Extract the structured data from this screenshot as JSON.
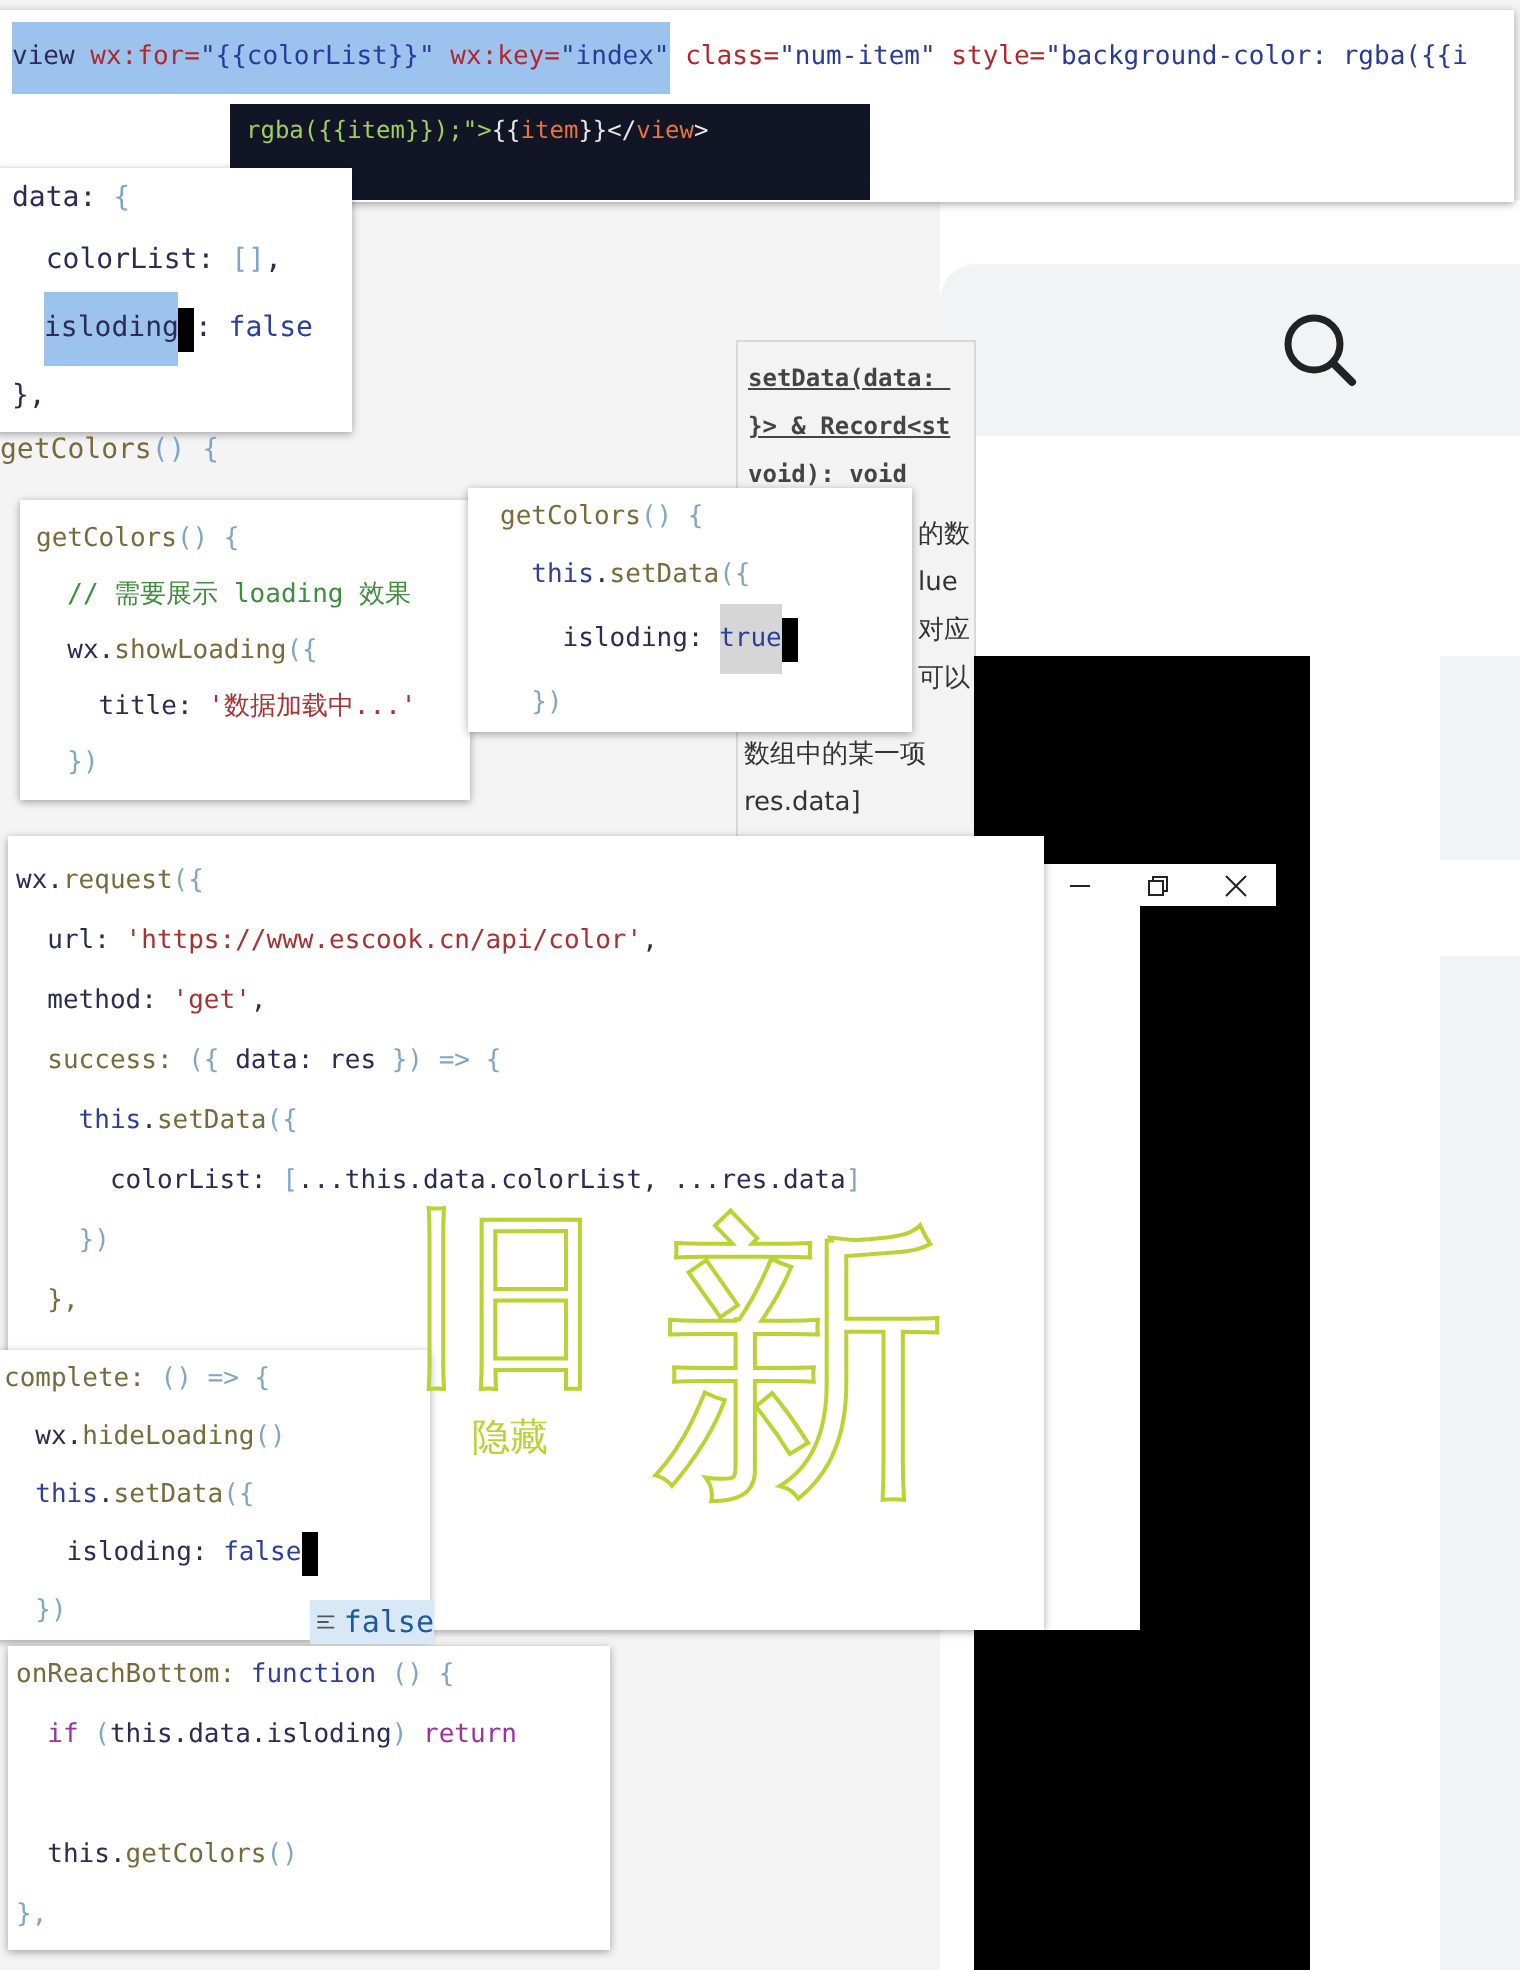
{
  "snippets": [
    {
      "kind": "wide",
      "lines": [
        {
          "segments": [
            {
              "text": "view ",
              "kind": "plain",
              "selected": true
            },
            {
              "text": "wx:for=",
              "kind": "tag",
              "selected": true
            },
            {
              "text": "\"{{colorList}}\"",
              "kind": "val",
              "selected": true
            },
            {
              "text": " wx:key=",
              "kind": "tag",
              "selected": true
            },
            {
              "text": "\"index\"",
              "kind": "val",
              "selected": true
            },
            {
              "text": " class=",
              "kind": "tag"
            },
            {
              "text": "\"num-item\"",
              "kind": "val"
            },
            {
              "text": " style=",
              "kind": "tag"
            },
            {
              "text": "\"background-color: rgba({{i",
              "kind": "val"
            }
          ]
        }
      ]
    },
    {
      "kind": "dark",
      "lines": [
        {
          "segments": [
            {
              "text": "rgba({{item}});\">",
              "kind": "str"
            },
            {
              "text": "{{",
              "kind": "plain"
            },
            {
              "text": "item",
              "kind": "tag"
            },
            {
              "text": "}}</",
              "kind": "plain"
            },
            {
              "text": "view",
              "kind": "tag"
            },
            {
              "text": ">",
              "kind": "plain"
            }
          ]
        }
      ]
    },
    {
      "kind": "code",
      "lines": [
        {
          "segments": [
            {
              "text": "data: ",
              "kind": "plain"
            },
            {
              "text": "{",
              "kind": "punc"
            }
          ]
        },
        {
          "segments": [
            {
              "text": "  colorList: ",
              "kind": "plain"
            },
            {
              "text": "[]",
              "kind": "punc"
            },
            {
              "text": ",",
              "kind": "plain"
            }
          ]
        },
        {
          "segments": [
            {
              "text": "isloding",
              "kind": "plain",
              "selected": true,
              "cursor": true
            },
            {
              "text": ": ",
              "kind": "plain"
            },
            {
              "text": "false",
              "kind": "bool"
            }
          ]
        },
        {
          "segments": [
            {
              "text": "},",
              "kind": "plain"
            }
          ]
        }
      ]
    },
    {
      "kind": "code",
      "lines": [
        {
          "segments": [
            {
              "text": "getColors",
              "kind": "fn"
            },
            {
              "text": "() {",
              "kind": "punc"
            }
          ]
        }
      ]
    },
    {
      "kind": "code",
      "lines": [
        {
          "segments": [
            {
              "text": "getColors",
              "kind": "fn"
            },
            {
              "text": "() {",
              "kind": "punc"
            }
          ]
        },
        {
          "segments": [
            {
              "text": "  // 需要展示 loading 效果",
              "kind": "com"
            }
          ]
        },
        {
          "segments": [
            {
              "text": "  wx.",
              "kind": "plain"
            },
            {
              "text": "showLoading",
              "kind": "fn"
            },
            {
              "text": "({",
              "kind": "punc"
            }
          ]
        },
        {
          "segments": [
            {
              "text": "    title: ",
              "kind": "plain"
            },
            {
              "text": "'数据加载中...'",
              "kind": "str"
            }
          ]
        },
        {
          "segments": [
            {
              "text": "  })",
              "kind": "punc"
            }
          ]
        }
      ]
    },
    {
      "kind": "code",
      "lines": [
        {
          "segments": [
            {
              "text": "getColors",
              "kind": "fn"
            },
            {
              "text": "() {",
              "kind": "punc"
            }
          ]
        },
        {
          "segments": [
            {
              "text": "  this",
              "kind": "kw2"
            },
            {
              "text": ".",
              "kind": "plain"
            },
            {
              "text": "setData",
              "kind": "fn"
            },
            {
              "text": "({",
              "kind": "punc"
            }
          ]
        },
        {
          "segments": [
            {
              "text": "    isloding: ",
              "kind": "plain"
            },
            {
              "text": "true",
              "kind": "bool",
              "selected": true,
              "cursor": true
            }
          ]
        },
        {
          "segments": [
            {
              "text": "  })",
              "kind": "punc"
            }
          ]
        }
      ]
    },
    {
      "kind": "code",
      "lines": [
        {
          "segments": [
            {
              "text": "wx.",
              "kind": "plain"
            },
            {
              "text": "request",
              "kind": "fn"
            },
            {
              "text": "({",
              "kind": "punc"
            }
          ]
        },
        {
          "segments": [
            {
              "text": "  url: ",
              "kind": "plain"
            },
            {
              "text": "'https://www.escook.cn/api/color'",
              "kind": "str"
            },
            {
              "text": ",",
              "kind": "plain"
            }
          ]
        },
        {
          "segments": [
            {
              "text": "  method: ",
              "kind": "plain"
            },
            {
              "text": "'get'",
              "kind": "str"
            },
            {
              "text": ",",
              "kind": "plain"
            }
          ]
        },
        {
          "segments": [
            {
              "text": "  success: ",
              "kind": "fn"
            },
            {
              "text": "({ ",
              "kind": "punc"
            },
            {
              "text": "data: res ",
              "kind": "plain"
            },
            {
              "text": "}) => {",
              "kind": "punc"
            }
          ]
        },
        {
          "segments": [
            {
              "text": "    this",
              "kind": "kw2"
            },
            {
              "text": ".",
              "kind": "plain"
            },
            {
              "text": "setData",
              "kind": "fn"
            },
            {
              "text": "({",
              "kind": "punc"
            }
          ]
        },
        {
          "segments": [
            {
              "text": "      colorList: ",
              "kind": "plain"
            },
            {
              "text": "[",
              "kind": "punc"
            },
            {
              "text": "...this.data.colorList, ...res.data",
              "kind": "plain"
            },
            {
              "text": "]",
              "kind": "punc"
            }
          ]
        },
        {
          "segments": [
            {
              "text": "    })",
              "kind": "punc"
            }
          ]
        },
        {
          "segments": [
            {
              "text": "  },",
              "kind": "fn"
            }
          ]
        }
      ]
    },
    {
      "kind": "code",
      "lines": [
        {
          "segments": [
            {
              "text": "complete: ",
              "kind": "fn"
            },
            {
              "text": "() => {",
              "kind": "punc"
            }
          ]
        },
        {
          "segments": [
            {
              "text": "  wx.",
              "kind": "plain"
            },
            {
              "text": "hideLoading",
              "kind": "fn"
            },
            {
              "text": "()",
              "kind": "punc"
            }
          ]
        },
        {
          "segments": [
            {
              "text": "  this",
              "kind": "kw2"
            },
            {
              "text": ".",
              "kind": "plain"
            },
            {
              "text": "setData",
              "kind": "fn"
            },
            {
              "text": "({",
              "kind": "punc"
            }
          ]
        },
        {
          "segments": [
            {
              "text": "    isloding: ",
              "kind": "plain"
            },
            {
              "text": "false",
              "kind": "bool",
              "cursor": true
            }
          ]
        },
        {
          "segments": [
            {
              "text": "  })",
              "kind": "punc"
            }
          ]
        }
      ]
    },
    {
      "kind": "code",
      "lines": [
        {
          "segments": [
            {
              "text": "onReachBottom: ",
              "kind": "fn"
            },
            {
              "text": "function ",
              "kind": "kw2"
            },
            {
              "text": "() {",
              "kind": "punc"
            }
          ]
        },
        {
          "segments": [
            {
              "text": "  if ",
              "kind": "kw"
            },
            {
              "text": "(",
              "kind": "punc"
            },
            {
              "text": "this.data.isloding",
              "kind": "plain"
            },
            {
              "text": ") ",
              "kind": "punc"
            },
            {
              "text": "return",
              "kind": "kw"
            }
          ]
        },
        {
          "segments": [
            {
              "text": "  this.",
              "kind": "plain"
            },
            {
              "text": "getColors",
              "kind": "fn"
            },
            {
              "text": "()",
              "kind": "punc"
            }
          ]
        },
        {
          "segments": [
            {
              "text": "},",
              "kind": "punc"
            }
          ]
        }
      ]
    }
  ],
  "tooltip": {
    "lines": [
      "setData(data: ",
      "}> & Record<st",
      "void): void"
    ]
  },
  "doc_fragments": [
    "的数",
    "lue",
    "对应",
    "可以",
    "数组中的某一项",
    "res.data]"
  ],
  "suggestion": {
    "text": "false"
  },
  "note": "隐藏",
  "handwriting": [
    "旧",
    "新"
  ]
}
